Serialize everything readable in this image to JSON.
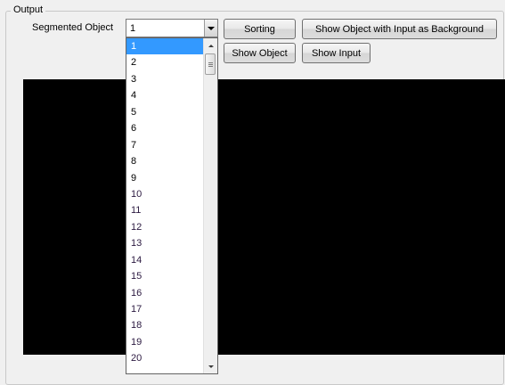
{
  "output_group": {
    "title": "Output",
    "combo_label": "Segmented Object",
    "combo_value": "1"
  },
  "buttons": {
    "sorting": "Sorting",
    "show_with_background": "Show Object with Input as Background",
    "show_object": "Show Object",
    "show_input": "Show Input"
  },
  "dropdown": {
    "selected_index": 0,
    "items": [
      "1",
      "2",
      "3",
      "4",
      "5",
      "6",
      "7",
      "8",
      "9",
      "10",
      "11",
      "12",
      "13",
      "14",
      "15",
      "16",
      "17",
      "18",
      "19",
      "20"
    ]
  },
  "colors": {
    "selection": "#3399ff",
    "canvas": "#000000"
  }
}
